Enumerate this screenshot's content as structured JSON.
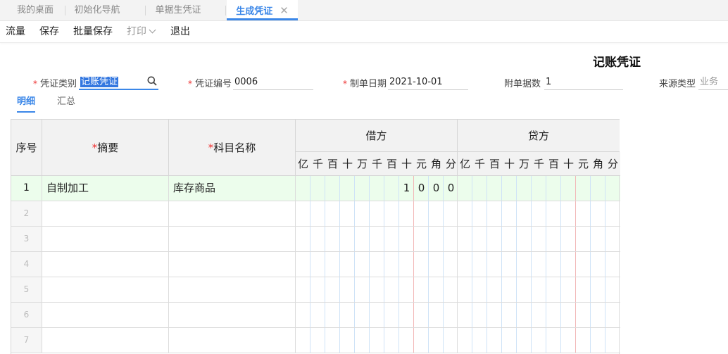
{
  "tabs": [
    {
      "label": "我的桌面",
      "active": false
    },
    {
      "label": "初始化导航",
      "active": false
    },
    {
      "label": "单据生凭证",
      "active": false
    },
    {
      "label": "生成凭证",
      "active": true
    }
  ],
  "tab_close_glyph": "✕",
  "toolbar": {
    "flow": "流量",
    "save": "保存",
    "batch_save": "批量保存",
    "print": "打印",
    "exit": "退出"
  },
  "voucher": {
    "title": "记账凭证",
    "type_label": "凭证类别",
    "type_value": "记账凭证",
    "number_label": "凭证编号",
    "number_value": "0006",
    "date_label": "制单日期",
    "date_value": "2021-10-01",
    "attachments_label": "附单据数",
    "attachments_value": "1",
    "source_label": "来源类型",
    "source_value": "业务"
  },
  "subtabs": {
    "detail": "明细",
    "summary": "汇总"
  },
  "grid": {
    "col_seq": "序号",
    "col_summary": "摘要",
    "col_account": "科目名称",
    "col_debit": "借方",
    "col_credit": "贷方",
    "required_mark": "*",
    "digit_units": [
      "亿",
      "千",
      "百",
      "十",
      "万",
      "千",
      "百",
      "十",
      "元",
      "角",
      "分"
    ],
    "rows": [
      {
        "seq": "1",
        "summary": "自制加工",
        "account": "库存商品",
        "debit_digits": [
          "",
          "",
          "",
          "",
          "",
          "",
          "",
          "1",
          "0",
          "0",
          "0"
        ],
        "credit_digits": [
          "",
          "",
          "",
          "",
          "",
          "",
          "",
          "",
          "",
          "",
          ""
        ]
      },
      {
        "seq": "2",
        "summary": "",
        "account": ""
      },
      {
        "seq": "3",
        "summary": "",
        "account": ""
      },
      {
        "seq": "4",
        "summary": "",
        "account": ""
      },
      {
        "seq": "5",
        "summary": "",
        "account": ""
      },
      {
        "seq": "6",
        "summary": "",
        "account": ""
      },
      {
        "seq": "7",
        "summary": "",
        "account": ""
      }
    ]
  },
  "colors": {
    "accent": "#3b87e8",
    "required": "#e33333",
    "row_highlight": "#ecfdec",
    "yuan_divider": "#f2b8b8",
    "digit_divider": "#cfe3f7"
  },
  "icons": {
    "search": "search-icon",
    "close": "close-icon",
    "chevron": "chevron-down-icon"
  }
}
